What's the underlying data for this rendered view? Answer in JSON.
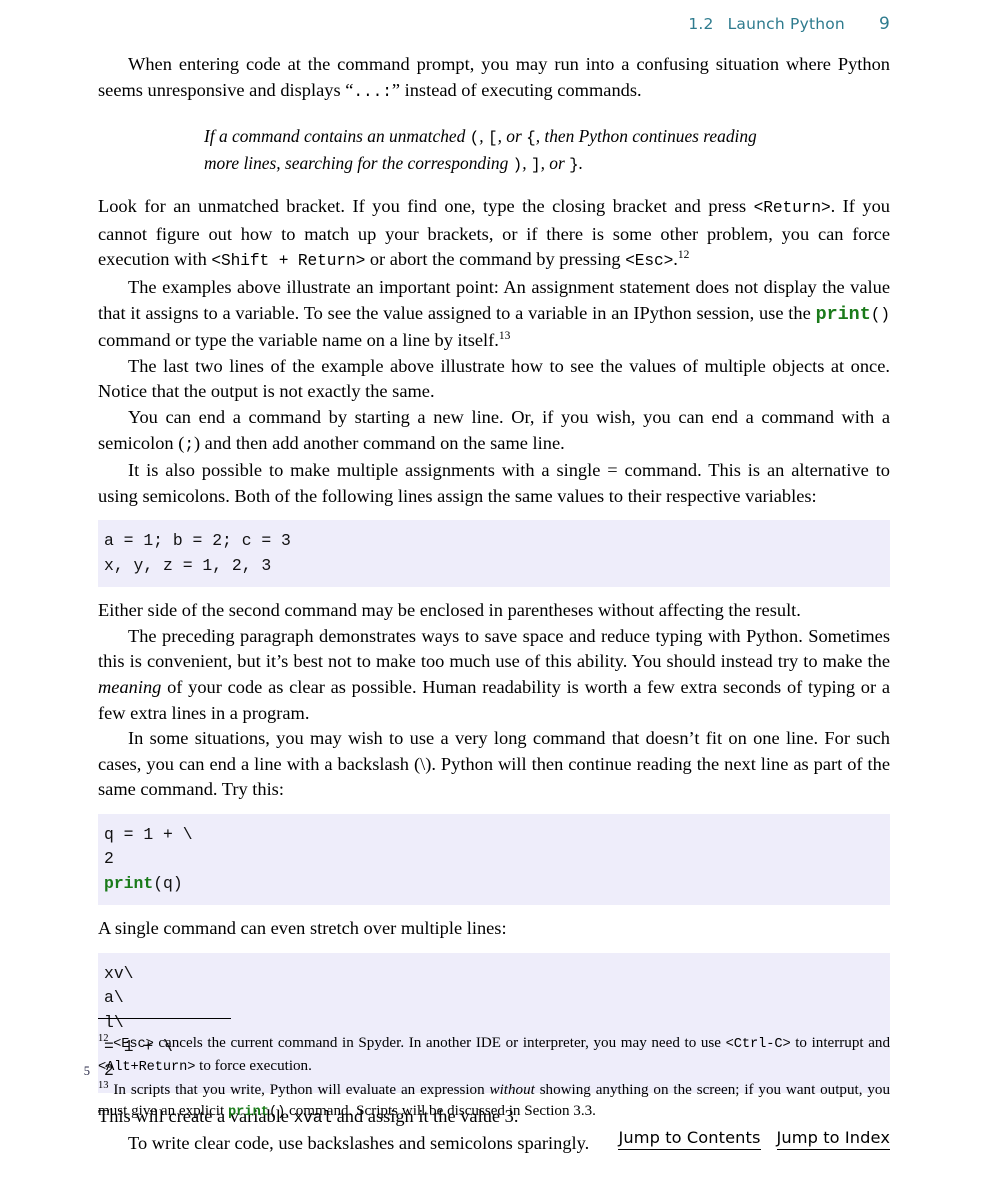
{
  "header": {
    "section_number": "1.2",
    "section_title": "Launch Python",
    "page_number": "9"
  },
  "body": {
    "p1": "When entering code at the command prompt, you may run into a confusing situation where Python seems unresponsive and displays “",
    "p1_code": "...:",
    "p1_end": "” instead of executing commands.",
    "quote_line1_a": "If a command contains an unmatched ",
    "quote_line1_b": "(",
    "quote_line1_c": ", ",
    "quote_line1_d": "[",
    "quote_line1_e": ", or ",
    "quote_line1_f": "{",
    "quote_line1_g": ", then Python continues reading",
    "quote_line2_a": "more lines, searching for the corresponding ",
    "quote_line2_b": ")",
    "quote_line2_c": ", ",
    "quote_line2_d": "]",
    "quote_line2_e": ", or ",
    "quote_line2_f": "}",
    "quote_line2_g": ".",
    "p2_a": "Look for an unmatched bracket. If you find one, type the closing bracket and press ",
    "p2_code1": "<Return>",
    "p2_b": ". If you cannot figure out how to match up your brackets, or if there is some other problem, you can force execution with ",
    "p2_code2": "<Shift + Return>",
    "p2_c": " or abort the command by pressing ",
    "p2_code3": "<Esc>",
    "p2_d": ".",
    "p2_sup": "12",
    "p3_a": "The examples above illustrate an important point: An assignment statement does not display the value that it assigns to a variable. To see the value assigned to a variable in an IPython session, use the ",
    "p3_kw": "print",
    "p3_code": "()",
    "p3_b": " command or type the variable name on a line by itself.",
    "p3_sup": "13",
    "p4": "The last two lines of the example above illustrate how to see the values of multiple objects at once. Notice that the output is not exactly the same.",
    "p5_a": "You can end a command by starting a new line. Or, if you wish, you can end a command with a semicolon (",
    "p5_code": ";",
    "p5_b": ") and then add another command on the same line.",
    "p6": "It is also possible to make multiple assignments with a single = command. This is an alternative to using semicolons. Both of the following lines assign the same values to their respective variables:",
    "p7": "Either side of the second command may be enclosed in parentheses without affecting the result.",
    "p8_a": "The preceding paragraph demonstrates ways to save space and reduce typing with Python. Sometimes this is convenient, but it’s best not to make too much use of this ability. You should instead try to make the ",
    "p8_em": "meaning",
    "p8_b": " of your code as clear as possible. Human readability is worth a few extra seconds of typing or a few extra lines in a program.",
    "p9": "In some situations, you may wish to use a very long command that doesn’t fit on one line. For such cases, you can end a line with a backslash (\\). Python will then continue reading the next line as part of the same command. Try this:",
    "p10": "A single command can even stretch over multiple lines:",
    "p11_a": "This will create a variable ",
    "p11_code": "xval",
    "p11_b": " and assign it the value 3.",
    "p12": "To write clear code, use backslashes and semicolons sparingly."
  },
  "code_blocks": {
    "block1": {
      "lines": [
        {
          "text": "a = 1; b = 2; c = 3"
        },
        {
          "text": "x, y, z = 1, 2, 3"
        }
      ]
    },
    "block2": {
      "lines": [
        {
          "text": "q = 1 + \\"
        },
        {
          "text": "2"
        },
        {
          "keyword": "print",
          "text": "(q)"
        }
      ]
    },
    "block3": {
      "lines": [
        {
          "text": "xv\\"
        },
        {
          "text": "a\\"
        },
        {
          "text": "l\\"
        },
        {
          "text": "= 1 + \\"
        },
        {
          "text": "2",
          "lineno": "5"
        }
      ]
    }
  },
  "footnotes": [
    {
      "marker": "12",
      "a": "",
      "code1": "<Esc>",
      "b": " cancels the current command in Spyder. In another IDE or interpreter, you may need to use ",
      "code2": "<Ctrl-C>",
      "c": " to interrupt and ",
      "code3": "<Alt+Return>",
      "d": " to force execution."
    },
    {
      "marker": "13",
      "a": " In scripts that you write, Python will evaluate an expression ",
      "em": "without",
      "b": " showing anything on the screen; if you want output, you must give an explicit ",
      "kw": "print",
      "code1": "()",
      "c": " command. Scripts will be discussed in Section 3.3."
    }
  ],
  "footer": {
    "contents_link": "Jump to Contents",
    "index_link": "Jump to Index"
  },
  "colors": {
    "header_teal": "#2e7b8e",
    "code_bg": "#eeedfa",
    "keyword_green": "#1a7a1a",
    "lineno": "#2b2b4a"
  }
}
